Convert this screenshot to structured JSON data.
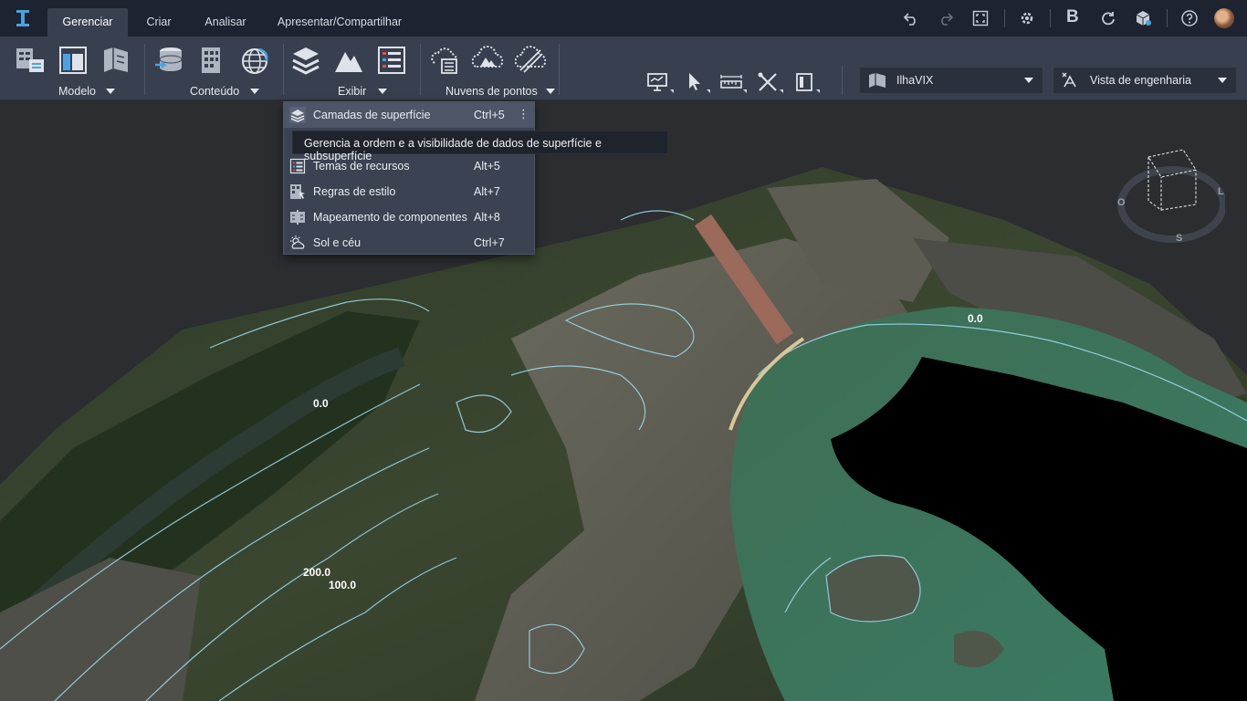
{
  "tabs": [
    {
      "label": "Gerenciar",
      "active": true
    },
    {
      "label": "Criar",
      "active": false
    },
    {
      "label": "Analisar",
      "active": false
    },
    {
      "label": "Apresentar/Compartilhar",
      "active": false
    }
  ],
  "topbar": {
    "b_label": "B",
    "icons": [
      "undo-icon",
      "redo-icon",
      "fit-view-icon",
      "settings-icon",
      "b-app-icon",
      "sync-icon",
      "model-cube-icon",
      "help-icon",
      "avatar"
    ]
  },
  "ribbon": {
    "groups": [
      {
        "label": "Modelo"
      },
      {
        "label": "Conteúdo"
      },
      {
        "label": "Exibir"
      },
      {
        "label": "Nuvens de pontos"
      }
    ],
    "model_selector": {
      "value": "IlhaVIX"
    },
    "view_selector": {
      "value": "Vista de engenharia"
    }
  },
  "menu": {
    "items": [
      {
        "label": "Camadas de superfície",
        "shortcut": "Ctrl+5",
        "more": "⋮"
      },
      {
        "label": "Temas de recursos",
        "shortcut": "Alt+5"
      },
      {
        "label": "Regras de estilo",
        "shortcut": "Alt+7"
      },
      {
        "label": "Mapeamento de componentes",
        "shortcut": "Alt+8"
      },
      {
        "label": "Sol e céu",
        "shortcut": "Ctrl+7"
      }
    ],
    "tooltip": "Gerencia a ordem e a visibilidade de dados de superfície e subsuperfície"
  },
  "viewport": {
    "contour_labels": [
      "0.0",
      "0.0",
      "200.0",
      "100.0"
    ],
    "compass": {
      "west": "O",
      "east": "L",
      "south": "S"
    }
  },
  "colors": {
    "topbar": "#1d2330",
    "ribbon": "#38404f",
    "accent_blue": "#4aa3e0",
    "water": "#3f7a5e",
    "contour": "#9fdcf0"
  }
}
